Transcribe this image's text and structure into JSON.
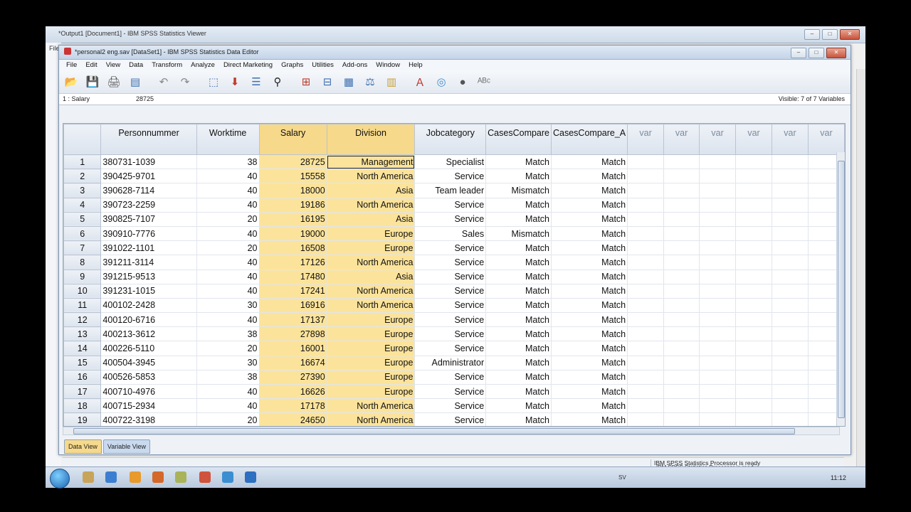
{
  "viewer": {
    "title": "*Output1 [Document1] - IBM SPSS Statistics Viewer",
    "menu_first": "File",
    "status": "IBM SPSS Statistics Processor is ready"
  },
  "editor": {
    "title": "*personal2 eng.sav [DataSet1] - IBM SPSS Statistics Data Editor",
    "menu": [
      "File",
      "Edit",
      "View",
      "Data",
      "Transform",
      "Analyze",
      "Direct Marketing",
      "Graphs",
      "Utilities",
      "Add-ons",
      "Window",
      "Help"
    ],
    "toolbar_icons": [
      "open-icon",
      "save-icon",
      "print-icon",
      "dialog-recall-icon",
      "undo-icon",
      "redo-icon",
      "goto-case-icon",
      "goto-variable-icon",
      "variables-icon",
      "find-icon",
      "insert-cases-icon",
      "insert-variable-icon",
      "split-file-icon",
      "weight-cases-icon",
      "select-cases-icon",
      "value-labels-icon",
      "use-sets-icon",
      "show-all-icon",
      "spell-check-icon"
    ],
    "cell_ref": "1 : Salary",
    "cell_value": "28725",
    "visible": "Visible: 7 of 7 Variables",
    "columns": [
      "Personnummer",
      "Worktime",
      "Salary",
      "Division",
      "Jobcategory",
      "CasesCompare",
      "CasesCompare_A",
      "var",
      "var",
      "var",
      "var",
      "var",
      "var"
    ],
    "rows": [
      [
        "1",
        "380731-1039",
        "38",
        "28725",
        "Management",
        "Specialist",
        "Match",
        "Match"
      ],
      [
        "2",
        "390425-9701",
        "40",
        "15558",
        "North America",
        "Service",
        "Match",
        "Match"
      ],
      [
        "3",
        "390628-7114",
        "40",
        "18000",
        "Asia",
        "Team leader",
        "Mismatch",
        "Match"
      ],
      [
        "4",
        "390723-2259",
        "40",
        "19186",
        "North America",
        "Service",
        "Match",
        "Match"
      ],
      [
        "5",
        "390825-7107",
        "20",
        "16195",
        "Asia",
        "Service",
        "Match",
        "Match"
      ],
      [
        "6",
        "390910-7776",
        "40",
        "19000",
        "Europe",
        "Sales",
        "Mismatch",
        "Match"
      ],
      [
        "7",
        "391022-1101",
        "20",
        "16508",
        "Europe",
        "Service",
        "Match",
        "Match"
      ],
      [
        "8",
        "391211-3114",
        "40",
        "17126",
        "North America",
        "Service",
        "Match",
        "Match"
      ],
      [
        "9",
        "391215-9513",
        "40",
        "17480",
        "Asia",
        "Service",
        "Match",
        "Match"
      ],
      [
        "10",
        "391231-1015",
        "40",
        "17241",
        "North America",
        "Service",
        "Match",
        "Match"
      ],
      [
        "11",
        "400102-2428",
        "30",
        "16916",
        "North America",
        "Service",
        "Match",
        "Match"
      ],
      [
        "12",
        "400120-6716",
        "40",
        "17137",
        "Europe",
        "Service",
        "Match",
        "Match"
      ],
      [
        "13",
        "400213-3612",
        "38",
        "27898",
        "Europe",
        "Service",
        "Match",
        "Match"
      ],
      [
        "14",
        "400226-5110",
        "20",
        "16001",
        "Europe",
        "Service",
        "Match",
        "Match"
      ],
      [
        "15",
        "400504-3945",
        "30",
        "16674",
        "Europe",
        "Administrator",
        "Match",
        "Match"
      ],
      [
        "16",
        "400526-5853",
        "38",
        "27390",
        "Europe",
        "Service",
        "Match",
        "Match"
      ],
      [
        "17",
        "400710-4976",
        "40",
        "16626",
        "Europe",
        "Service",
        "Match",
        "Match"
      ],
      [
        "18",
        "400715-2934",
        "40",
        "17178",
        "North America",
        "Service",
        "Match",
        "Match"
      ],
      [
        "19",
        "400722-3198",
        "20",
        "24650",
        "North America",
        "Service",
        "Match",
        "Match"
      ]
    ],
    "tabs": [
      "Data View",
      "Variable View"
    ],
    "status": "IBM SPSS Statistics Processor is ready"
  },
  "taskbar": {
    "lang": "SV",
    "clock": "11:12"
  },
  "colors": {
    "selected_column": "#fbe39b",
    "header": "#dbe3ee"
  }
}
